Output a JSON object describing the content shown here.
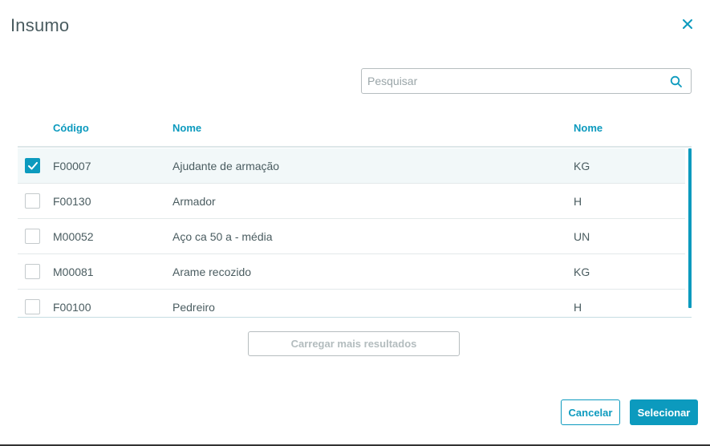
{
  "dialog": {
    "title": "Insumo"
  },
  "search": {
    "placeholder": "Pesquisar",
    "value": ""
  },
  "table": {
    "columns": [
      "Código",
      "Nome",
      "Nome"
    ],
    "rows": [
      {
        "selected": true,
        "code": "F00007",
        "name": "Ajudante de armação",
        "unit": "KG"
      },
      {
        "selected": false,
        "code": "F00130",
        "name": "Armador",
        "unit": "H"
      },
      {
        "selected": false,
        "code": "M00052",
        "name": "Aço ca 50 a - média",
        "unit": "UN"
      },
      {
        "selected": false,
        "code": "M00081",
        "name": "Arame recozido",
        "unit": "KG"
      },
      {
        "selected": false,
        "code": "F00100",
        "name": "Pedreiro",
        "unit": "H"
      }
    ]
  },
  "load_more_label": "Carregar mais resultados",
  "footer": {
    "cancel_label": "Cancelar",
    "select_label": "Selecionar"
  },
  "colors": {
    "accent": "#0c9abe",
    "text": "#4a5c60",
    "selected_row_bg": "#f2f8f9"
  },
  "icons": {
    "close": "close-icon",
    "search": "search-icon",
    "check": "check-icon"
  }
}
